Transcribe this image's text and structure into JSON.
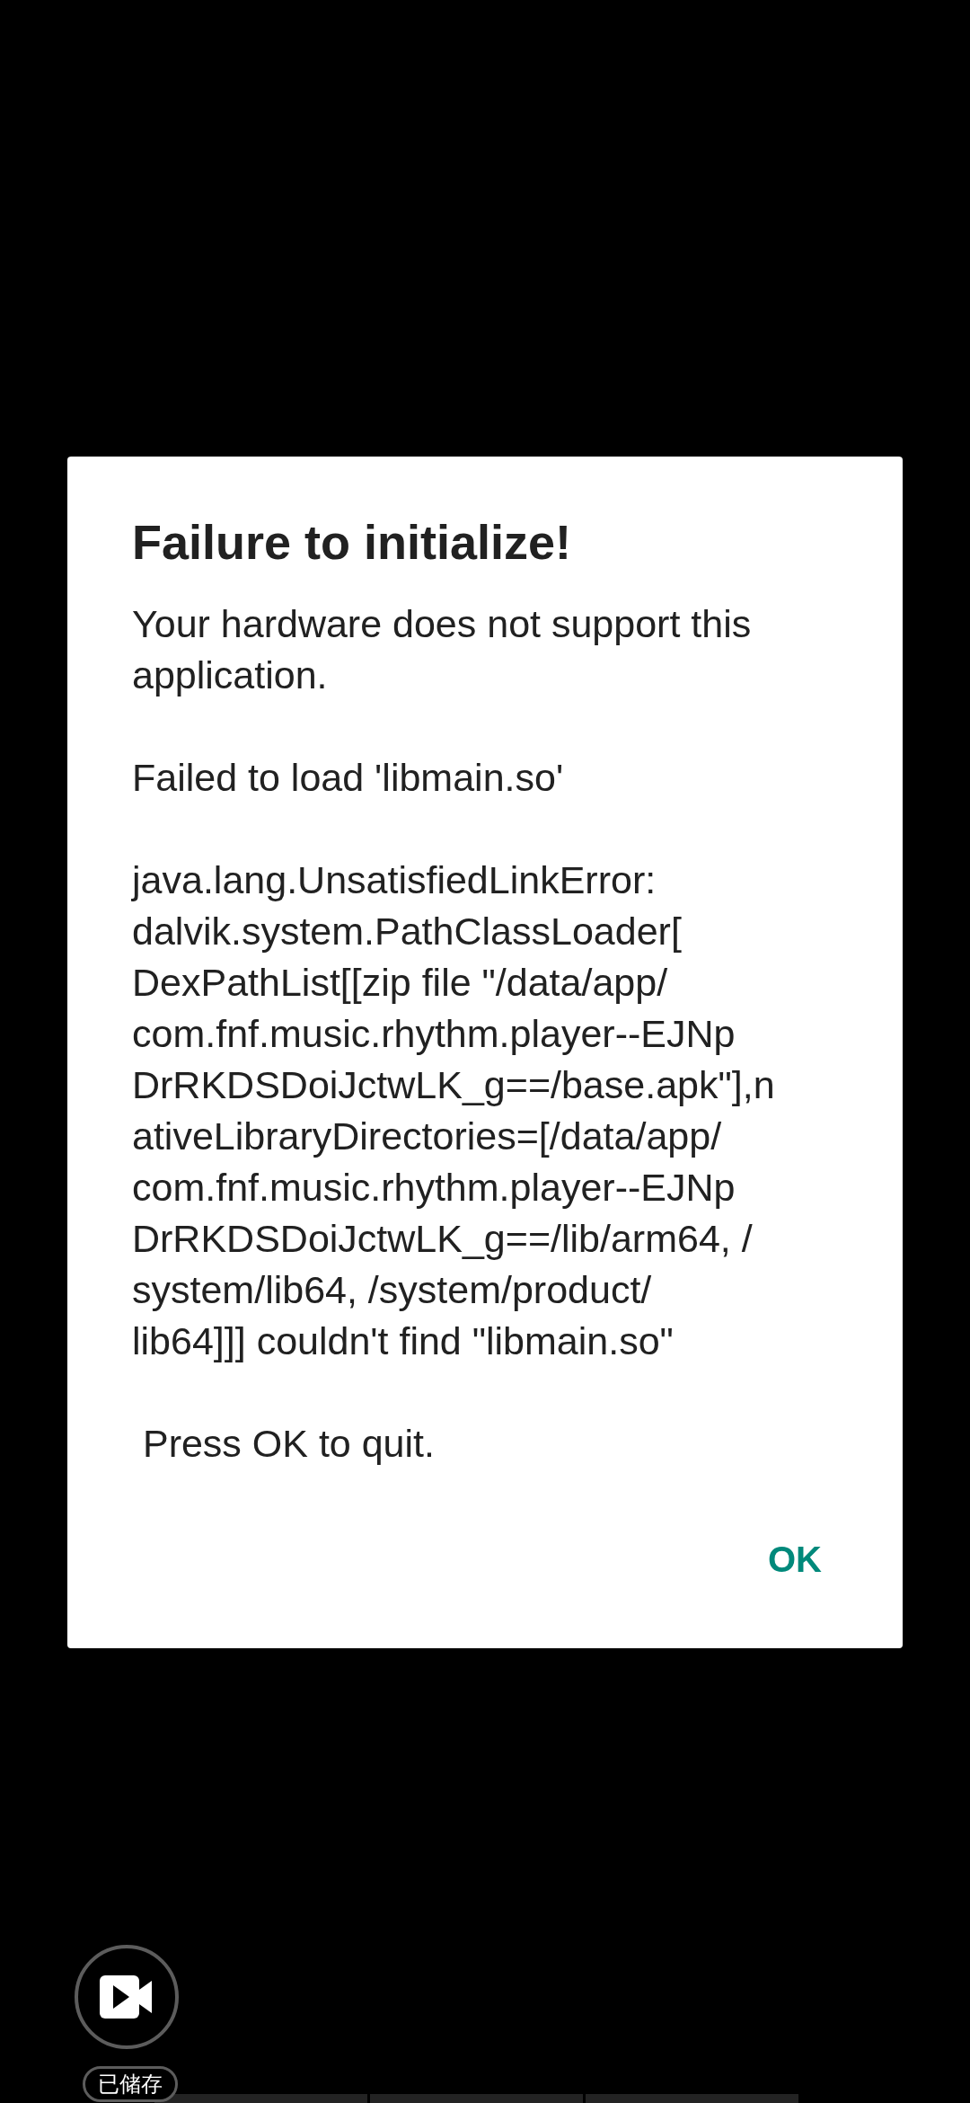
{
  "dialog": {
    "title": "Failure to initialize!",
    "paragraphs": [
      "Your hardware does not support this\napplication.",
      "Failed to load 'libmain.so'",
      "java.lang.UnsatisfiedLinkError:\ndalvik.system.PathClassLoader[\nDexPathList[[zip file \"/data/app/\ncom.fnf.music.rhythm.player--EJNp\nDrRKDSDoiJctwLK_g==/base.apk\"],n\nativeLibraryDirectories=[/data/app/\ncom.fnf.music.rhythm.player--EJNp\nDrRKDSDoiJctwLK_g==/lib/arm64, /\nsystem/lib64, /system/product/\nlib64]]] couldn't find \"libmain.so\"",
      " Press OK to quit."
    ],
    "buttons": [
      "OK"
    ]
  },
  "recorder": {
    "badge": "已储存"
  }
}
